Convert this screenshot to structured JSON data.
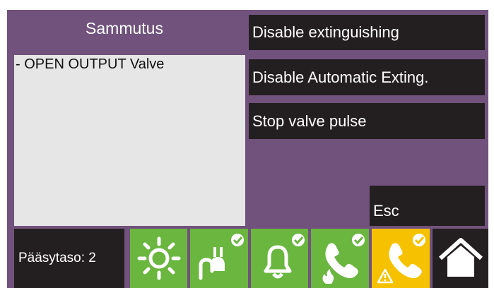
{
  "title": "Sammutus",
  "status_lines": [
    "- OPEN OUTPUT Valve"
  ],
  "buttons": {
    "disable_extinguishing": "Disable extinguishing",
    "disable_auto": "Disable Automatic Exting.",
    "stop_valve": "Stop valve pulse",
    "esc": "Esc"
  },
  "footer": {
    "access_level": "Pääsytaso: 2",
    "tiles": [
      {
        "icon": "sun-icon",
        "color": "#6ab63f",
        "checked": false
      },
      {
        "icon": "power-plug-icon",
        "color": "#6ab63f",
        "checked": true
      },
      {
        "icon": "bell-icon",
        "color": "#6ab63f",
        "checked": true
      },
      {
        "icon": "phone-fire-icon",
        "color": "#6ab63f",
        "checked": true
      },
      {
        "icon": "phone-warning-icon",
        "color": "#f6c200",
        "checked": true
      },
      {
        "icon": "home-icon",
        "color": "#231f20",
        "checked": false
      }
    ]
  },
  "colors": {
    "frame": "#71527d",
    "panel": "#231f20",
    "list_bg": "#e6e6e6",
    "ok_green": "#6ab63f",
    "warning_yellow": "#f6c200"
  }
}
